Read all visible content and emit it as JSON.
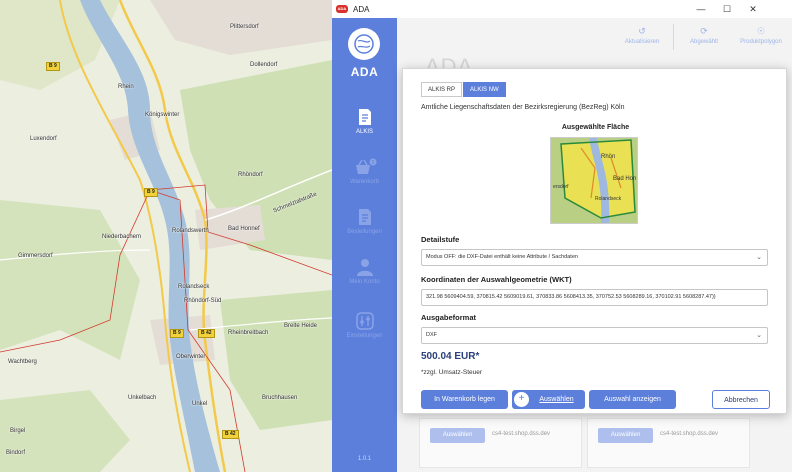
{
  "map": {
    "places": [
      "Plittersdorf",
      "Königswinter",
      "Bad Honnef",
      "Rhöndorf",
      "Niederbachem",
      "Gimmersdorf",
      "Rolandswerth",
      "Rolandseck",
      "Schmelztalstraße",
      "Oberwinter",
      "Rheinbreitbach",
      "Breite Heide",
      "Wachtberg",
      "Unkelbach",
      "Bruchhausen",
      "Unkel",
      "Birgel",
      "Bindorf",
      "Rhein",
      "Luxendorf",
      "Rhöndorf-Süd",
      "Dollendorf"
    ],
    "roads": [
      "B 9",
      "B 9",
      "B 9",
      "B 42",
      "B 42"
    ],
    "colors": {
      "river": "#a6c1dc",
      "forest": "#cfe0b4",
      "boundary": "#d23a2c",
      "road": "#f3c94a"
    }
  },
  "window": {
    "title": "ADA",
    "badge": "ADA",
    "controls": [
      "minimize-icon",
      "maximize-icon",
      "close-icon"
    ]
  },
  "sidebar": {
    "logo": "ADA",
    "version": "1.0.1",
    "accent": "#5c7fdc",
    "items": [
      {
        "label": "ALKIS",
        "icon": "document-icon",
        "active": true
      },
      {
        "label": "Warenkorb",
        "icon": "basket-icon",
        "active": false,
        "badge": "0"
      },
      {
        "label": "Bestellungen",
        "icon": "orders-icon",
        "active": false
      },
      {
        "label": "Mein Konto",
        "icon": "user-icon",
        "active": false
      },
      {
        "label": "Einstellungen",
        "icon": "settings-icon",
        "active": false
      }
    ]
  },
  "toolbar": {
    "refresh": "Aktualisieren",
    "deselect": "Abgewählt",
    "polygon": "Produktpolygon"
  },
  "background": {
    "title": "ADA",
    "cards": [
      {
        "button": "Auswählen",
        "host": "cs4-test.shop.dss.dev"
      },
      {
        "button": "Auswählen",
        "host": "cs4-test.shop.dss.dev"
      }
    ]
  },
  "dialog": {
    "tabs": [
      {
        "label": "ALKIS RP",
        "active": false
      },
      {
        "label": "ALKIS NW",
        "active": true
      }
    ],
    "source_desc": "Amtliche Liegenschaftsdaten der Bezirksregierung (BezReg) Köln",
    "selected_area_title": "Ausgewählte Fläche",
    "thumbnail_labels": [
      "Rhön",
      "Bad Hon",
      "ersdorf",
      "Rolandseck"
    ],
    "detail": {
      "label": "Detailstufe",
      "value": "Modus OFF: die DXF-Datei enthält keine Attribute / Sachdaten"
    },
    "wkt": {
      "label": "Koordinaten der Auswahlgeometrie (WKT)",
      "value": "321.98 5609404.59, 370815.42 5609019.61, 370833.86 5608413.35, 370752.53 5608289.16, 370102.91 5608287.47))"
    },
    "format": {
      "label": "Ausgabeformat",
      "value": "DXF"
    },
    "price": "500.04 EUR*",
    "tax_note": "*zzgl. Umsatz-Steuer",
    "buttons": {
      "cart": "In Warenkorb legen",
      "select": "Auswählen",
      "show": "Auswahl anzeigen",
      "cancel": "Abbrechen"
    }
  }
}
